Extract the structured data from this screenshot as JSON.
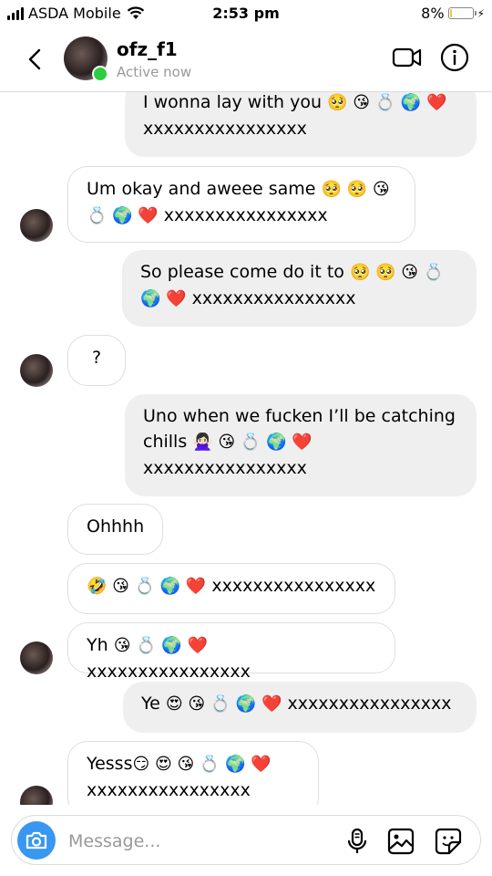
{
  "status_bar": {
    "carrier": "ASDA Mobile",
    "time": "2:53 pm",
    "battery_text": "8%",
    "battery_level": 0.08,
    "signal_icon": "signal-icon",
    "wifi_icon": "wifi-icon"
  },
  "header": {
    "username": "ofz_f1",
    "status": "Active now",
    "back_icon": "chevron-left-icon",
    "video_icon": "video-call-icon",
    "info_icon": "info-icon"
  },
  "messages": [
    {
      "direction": "out",
      "text": "I wonna lay with you",
      "emoji": "🥺 😘 💍 🌍 ❤️",
      "tail": "xxxxxxxxxxxxxxxx"
    },
    {
      "direction": "in",
      "text": "Um okay and aweee same",
      "emoji": "🥺 🥺 😘",
      "line2_emoji": "💍 🌍 ❤️",
      "tail": "xxxxxxxxxxxxxxxx"
    },
    {
      "direction": "out",
      "text": "So please come do it to",
      "emoji": "🥺 🥺 😘 💍",
      "line2_emoji": "🌍 ❤️",
      "tail": "xxxxxxxxxxxxxxxx"
    },
    {
      "direction": "in",
      "text": "?"
    },
    {
      "direction": "out",
      "text": "Uno when we fucken I’ll be catching",
      "line2_text": "chills",
      "emoji": "🙅🏻‍♀️ 😘 💍 🌍 ❤️",
      "tail": "xxxxxxxxxxxxxxxx"
    },
    {
      "direction": "in",
      "text": "Ohhhh"
    },
    {
      "direction": "in",
      "emoji": "🤣 😘 💍 🌍 ❤️",
      "tail": "xxxxxxxxxxxxxxxx"
    },
    {
      "direction": "in",
      "text": "Yh",
      "emoji": "😘 💍 🌍 ❤️",
      "tail": "xxxxxxxxxxxxxxxx"
    },
    {
      "direction": "out",
      "text": "Ye",
      "emoji": "😍 😘 💍 🌍 ❤️",
      "tail": "xxxxxxxxxxxxxxxx"
    },
    {
      "direction": "in",
      "text": "Yesss",
      "emoji": "😏 😍 😘 💍 🌍 ❤️",
      "tail": "xxxxxxxxxxxxxxxx"
    }
  ],
  "composer": {
    "placeholder": "Message...",
    "camera_icon": "camera-icon",
    "mic_icon": "microphone-icon",
    "gallery_icon": "gallery-icon",
    "sticker_icon": "sticker-icon"
  },
  "colors": {
    "accent": "#3897f0",
    "online": "#2ecc40",
    "outgoing_bubble": "#efefef",
    "incoming_border": "#dedede",
    "battery": "#f5c542"
  }
}
